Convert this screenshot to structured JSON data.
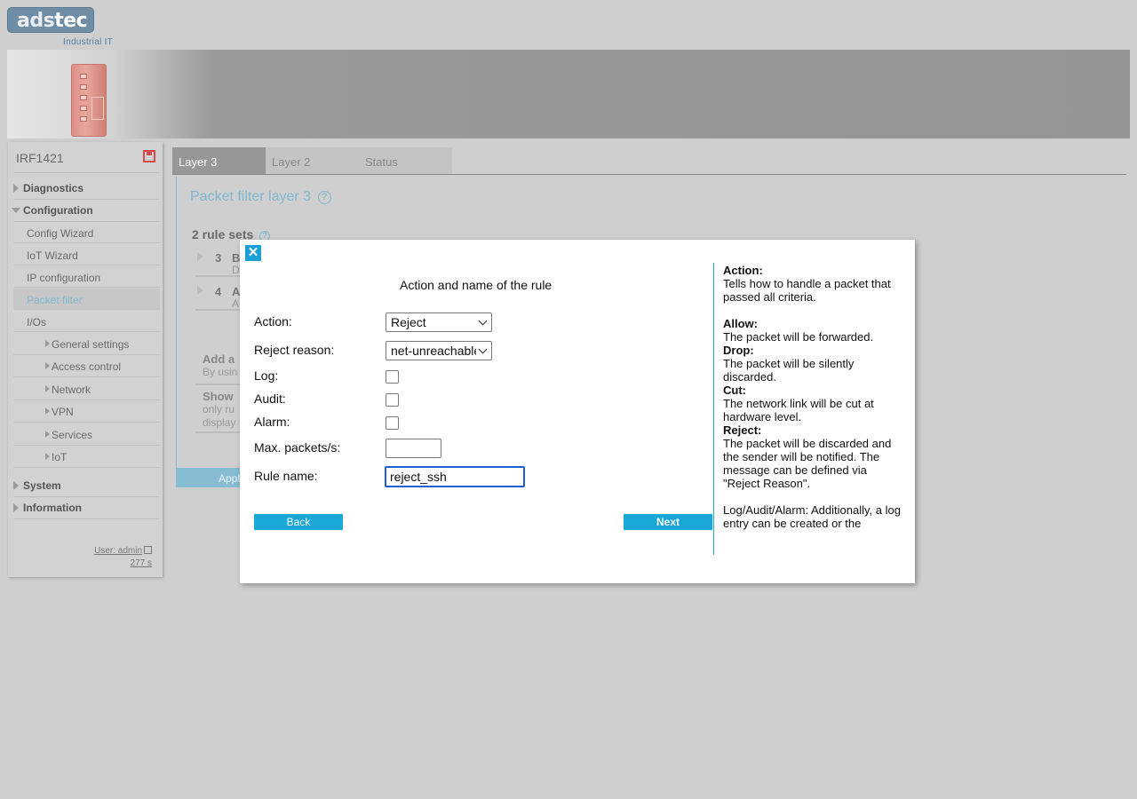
{
  "logo": {
    "brand_left": "ads",
    "brand_right": "tec",
    "subtitle": "Industrial IT"
  },
  "sidebar": {
    "device_name": "IRF1421",
    "nav": {
      "diagnostics": "Diagnostics",
      "configuration": "Configuration",
      "system": "System",
      "information": "Information"
    },
    "config_items": [
      "Config Wizard",
      "IoT Wizard",
      "IP configuration",
      "Packet filter",
      "I/Os"
    ],
    "io_items": [
      "General settings",
      "Access control",
      "Network",
      "VPN",
      "Services",
      "IoT"
    ],
    "user": "User: admin",
    "session_time": "277 s"
  },
  "tabs": [
    "Layer 3",
    "Layer 2",
    "Status"
  ],
  "main": {
    "page_title": "Packet filter layer 3",
    "rule_sets_label": "2 rule sets",
    "rule_sets": [
      {
        "num": "3",
        "name_fragment": "B",
        "desc_fragment": "D"
      },
      {
        "num": "4",
        "name_fragment": "A",
        "desc_fragment": "A"
      }
    ],
    "add_title_fragment": "Add a",
    "add_desc_fragment": "By usin",
    "show_title_fragment": "Show",
    "show_desc_fragment_1": "only ru",
    "show_desc_fragment_2": "display",
    "apply_fragment": "Appl"
  },
  "modal": {
    "close_symbol": "✕",
    "title": "Action and name of the rule",
    "fields": {
      "action_label": "Action:",
      "action_value": "Reject",
      "reject_reason_label": "Reject reason:",
      "reject_reason_value": "net-unreachable",
      "log_label": "Log:",
      "audit_label": "Audit:",
      "alarm_label": "Alarm:",
      "max_packets_label": "Max. packets/s:",
      "max_packets_value": "",
      "rule_name_label": "Rule name:",
      "rule_name_value": "reject_ssh"
    },
    "back_label": "Back",
    "next_label": "Next",
    "help": {
      "action_heading": "Action:",
      "action_text": "Tells how to handle a packet that passed all criteria.",
      "allow_heading": "Allow:",
      "allow_text": "The packet will be forwarded.",
      "drop_heading": "Drop:",
      "drop_text": "The packet will be silently discarded.",
      "cut_heading": "Cut:",
      "cut_text": "The network link will be cut at hardware level.",
      "reject_heading": "Reject:",
      "reject_text": "The packet will be discarded and the sender will be notified. The message can be defined via \"Reject Reason\".",
      "log_text": "Log/Audit/Alarm: Additionally, a log entry can be created or the"
    }
  },
  "colors": {
    "accent": "#1aa8d6",
    "sidebar_active": "#7fb8d0",
    "save_icon": "#d34a4a",
    "banner": "#959595"
  }
}
